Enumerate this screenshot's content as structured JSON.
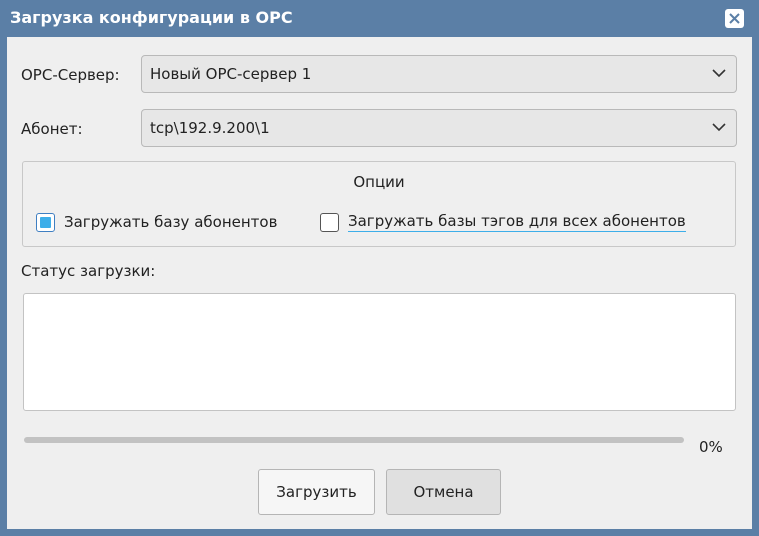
{
  "window": {
    "title": "Загрузка конфигурации в OPC"
  },
  "form": {
    "opc_server": {
      "label": "OPC-Сервер:",
      "value": "Новый OPC-сервер 1"
    },
    "subscriber": {
      "label": "Абонет:",
      "value": "tcp\\192.9.200\\1"
    }
  },
  "options": {
    "title": "Опции",
    "load_subscriber_db": {
      "label": "Загружать базу абонентов",
      "checked": true
    },
    "load_tag_dbs": {
      "label": "Загружать базы тэгов для всех абонентов",
      "checked": false
    }
  },
  "status": {
    "label": "Статус загрузки:",
    "text": ""
  },
  "progress": {
    "value": 0,
    "label": "0%"
  },
  "buttons": {
    "load": "Загрузить",
    "cancel": "Отмена"
  },
  "icons": {
    "close": "close-icon",
    "dropdown": "chevron-down-icon"
  },
  "colors": {
    "titlebar": "#5b7fa6",
    "accent": "#3daee9",
    "background": "#efefef"
  }
}
